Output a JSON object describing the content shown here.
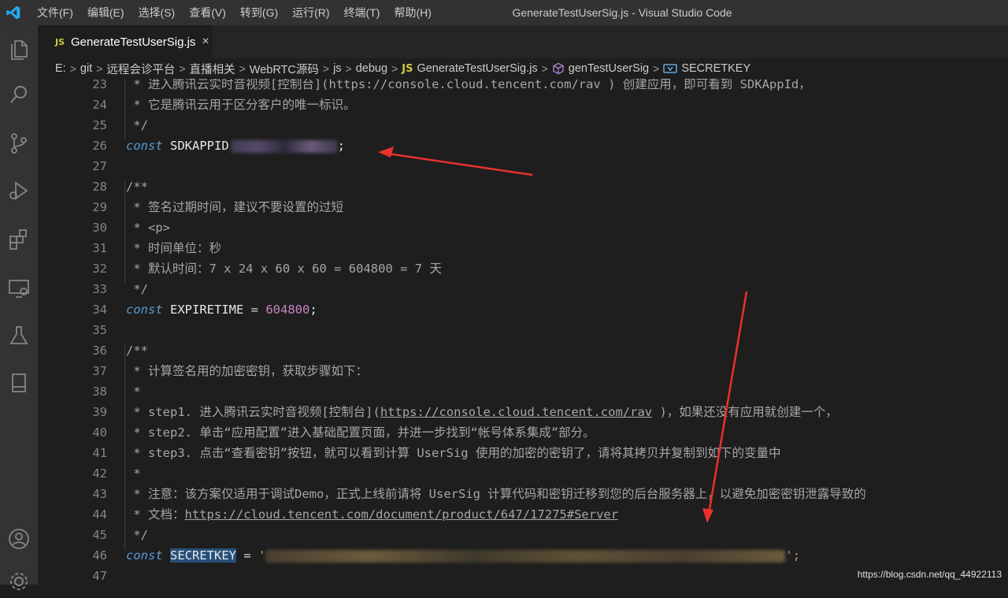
{
  "titlebar": {
    "menu": [
      "文件(F)",
      "编辑(E)",
      "选择(S)",
      "查看(V)",
      "转到(G)",
      "运行(R)",
      "终端(T)",
      "帮助(H)"
    ],
    "window_title": "GenerateTestUserSig.js - Visual Studio Code"
  },
  "activity_icons": [
    "files-icon",
    "search-icon",
    "source-control-icon",
    "run-debug-icon",
    "extensions-icon",
    "remote-explorer-icon",
    "testing-icon",
    "book-icon",
    "account-icon",
    "settings-gear-icon"
  ],
  "tab": {
    "badge": "JS",
    "label": "GenerateTestUserSig.js",
    "close": "×"
  },
  "breadcrumbs": {
    "items": [
      "E:",
      "git",
      "远程会诊平台",
      "直播相关",
      "WebRTC源码",
      "js",
      "debug",
      "GenerateTestUserSig.js",
      "genTestUserSig",
      "SECRETKEY"
    ],
    "sep": ">"
  },
  "code": {
    "l23": " * 进入腾讯云实时音视频[控制台](https://console.cloud.tencent.com/rav ) 创建应用，即可看到 SDKAppId，",
    "l24": " * 它是腾讯云用于区分客户的唯一标识。",
    "l25": " */",
    "l26_kw": "const",
    "l26_id": " SDKAPPID",
    "l26_end": ";",
    "l28": "/**",
    "l29": " * 签名过期时间，建议不要设置的过短",
    "l30": " * <p>",
    "l31": " * 时间单位：秒",
    "l32": " * 默认时间：7 x 24 x 60 x 60 = 604800 = 7 天",
    "l33": " */",
    "l34_kw": "const",
    "l34_id": " EXPIRETIME ",
    "l34_op": "= ",
    "l34_num": "604800",
    "l34_end": ";",
    "l36": "/**",
    "l37": " * 计算签名用的加密密钥，获取步骤如下：",
    "l38": " *",
    "l39a": " * step1. 进入腾讯云实时音视频[控制台](",
    "l39b": "https://console.cloud.tencent.com/rav",
    "l39c": " )，如果还没有应用就创建一个，",
    "l40": " * step2. 单击“应用配置”进入基础配置页面，并进一步找到“帐号体系集成”部分。",
    "l41": " * step3. 点击“查看密钥”按钮，就可以看到计算 UserSig 使用的加密的密钥了，请将其拷贝并复制到如下的变量中",
    "l42": " *",
    "l43": " * 注意：该方案仅适用于调试Demo，正式上线前请将 UserSig 计算代码和密钥迁移到您的后台服务器上，以避免加密密钥泄露导致的",
    "l44a": " * 文档：",
    "l44b": "https://cloud.tencent.com/document/product/647/17275#Server",
    "l45": " */",
    "l46_kw": "const",
    "l46_sp": " ",
    "l46_id": "SECRETKEY",
    "l46_op": " = ",
    "l46_q1": "'",
    "l46_q2": "';"
  },
  "line_numbers": [
    "23",
    "24",
    "25",
    "26",
    "27",
    "28",
    "29",
    "30",
    "31",
    "32",
    "33",
    "34",
    "35",
    "36",
    "37",
    "38",
    "39",
    "40",
    "41",
    "42",
    "43",
    "44",
    "45",
    "46",
    "47"
  ],
  "watermark": "https://blog.csdn.net/qq_44922113",
  "colors": {
    "arrow": "#e8322c",
    "keyword": "#569cd6",
    "number": "#c586c0",
    "comment": "#a6a6a6"
  }
}
